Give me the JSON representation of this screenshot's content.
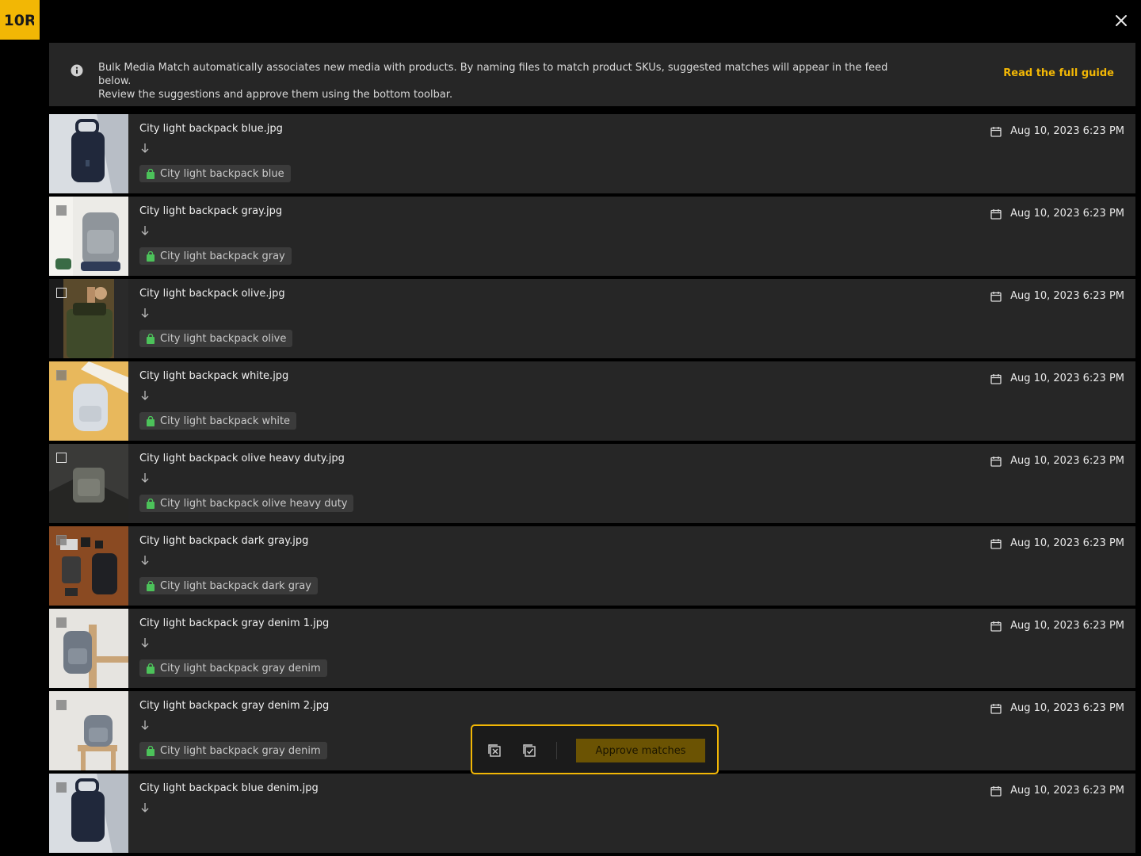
{
  "logo": {
    "text": "10R"
  },
  "banner": {
    "message_line1": "Bulk Media Match automatically associates new media with products. By naming files to match product SKUs, suggested matches will appear in the feed below.",
    "message_line2": "Review the suggestions and approve them using the bottom toolbar.",
    "guide_link": "Read the full guide"
  },
  "rows": [
    {
      "filename": "City light backpack blue.jpg",
      "product": "City light backpack blue",
      "date": "Aug 10, 2023 6:23 PM"
    },
    {
      "filename": "City light backpack gray.jpg",
      "product": "City light backpack gray",
      "date": "Aug 10, 2023 6:23 PM"
    },
    {
      "filename": "City light backpack olive.jpg",
      "product": "City light backpack olive",
      "date": "Aug 10, 2023 6:23 PM"
    },
    {
      "filename": "City light backpack white.jpg",
      "product": "City light backpack white",
      "date": "Aug 10, 2023 6:23 PM"
    },
    {
      "filename": "City light backpack olive heavy duty.jpg",
      "product": "City light backpack olive heavy duty",
      "date": "Aug 10, 2023 6:23 PM"
    },
    {
      "filename": "City light backpack dark gray.jpg",
      "product": "City light backpack dark gray",
      "date": "Aug 10, 2023 6:23 PM"
    },
    {
      "filename": "City light backpack gray denim 1.jpg",
      "product": "City light backpack gray denim",
      "date": "Aug 10, 2023 6:23 PM"
    },
    {
      "filename": "City light backpack gray denim 2.jpg",
      "product": "City light backpack gray denim",
      "date": "Aug 10, 2023 6:23 PM"
    },
    {
      "filename": "City light backpack blue denim.jpg",
      "product": "",
      "date": "Aug 10, 2023 6:23 PM"
    }
  ],
  "toolbar": {
    "approve_label": "Approve matches"
  },
  "icons": {
    "close": "close-icon",
    "info": "info-icon",
    "calendar": "calendar-icon",
    "arrow": "arrow-down-icon",
    "bag": "shopping-bag-icon",
    "deselect": "deselect-all-icon",
    "select": "select-all-icon"
  },
  "colors": {
    "accent": "#f2b705",
    "row_bg": "#262626",
    "bag_green": "#4cc25a"
  }
}
